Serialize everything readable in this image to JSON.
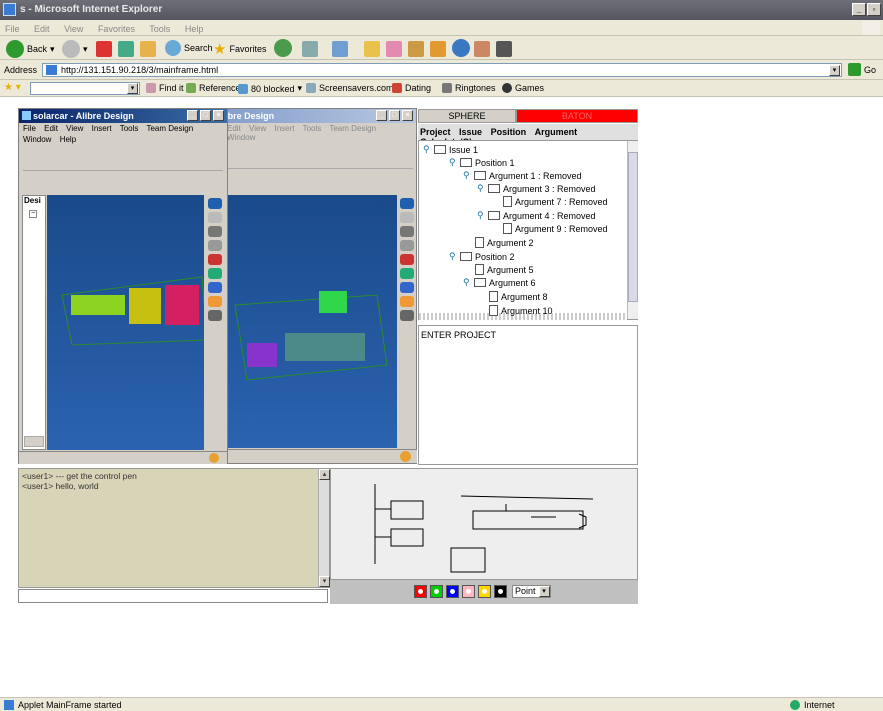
{
  "browser": {
    "title": "s - Microsoft Internet Explorer",
    "menu": [
      "File",
      "Edit",
      "View",
      "Favorites",
      "Tools",
      "Help"
    ],
    "toolbar": {
      "back": "Back",
      "search": "Search",
      "favorites": "Favorites"
    },
    "address_label": "Address",
    "url": "http://131.151.90.218/3/mainframe.html",
    "go_label": "Go",
    "links": {
      "find": "Find it",
      "reference": "Reference",
      "blocked": "80 blocked",
      "screensavers": "Screensavers.com",
      "dating": "Dating",
      "ringtones": "Ringtones",
      "games": "Games"
    },
    "status_text": "Applet MainFrame started",
    "zone": "Internet"
  },
  "alibre_left": {
    "title": "solarcar - Alibre Design",
    "menu1": [
      "File",
      "Edit",
      "View",
      "Insert",
      "Tools",
      "Team Design"
    ],
    "menu2": [
      "Window",
      "Help"
    ],
    "tree_label": "Desi"
  },
  "alibre_right": {
    "title": "sign - Alibre Design",
    "menu": [
      "Edit",
      "View",
      "Insert",
      "Tools",
      "Team Design",
      "Window"
    ]
  },
  "panel": {
    "tab_sphere": "SPHERE",
    "tab_baton": "BATON",
    "menu": [
      "Project",
      "Issue",
      "Position",
      "Argument",
      "Calculate/Clear"
    ],
    "tree": [
      {
        "label": "Issue 1",
        "type": "folder",
        "level": 0
      },
      {
        "label": "Position 1",
        "type": "folder",
        "level": 1
      },
      {
        "label": "Argument 1 : Removed",
        "type": "folder",
        "level": 2
      },
      {
        "label": "Argument 3 : Removed",
        "type": "folder",
        "level": 3
      },
      {
        "label": "Argument 7 : Removed",
        "type": "doc",
        "level": 4
      },
      {
        "label": "Argument 4 : Removed",
        "type": "folder",
        "level": 3
      },
      {
        "label": "Argument 9 : Removed",
        "type": "doc",
        "level": 4
      },
      {
        "label": "Argument 2",
        "type": "doc",
        "level": 2
      },
      {
        "label": "Position 2",
        "type": "folder",
        "level": 1
      },
      {
        "label": "Argument 5",
        "type": "doc",
        "level": 2
      },
      {
        "label": "Argument 6",
        "type": "folder",
        "level": 2
      },
      {
        "label": "Argument 8",
        "type": "doc",
        "level": 3
      },
      {
        "label": "Argument 10",
        "type": "doc",
        "level": 3
      }
    ],
    "project_text": "ENTER PROJECT"
  },
  "chat": {
    "lines": [
      "<user1> --- get the control pen",
      "<user1> hello, world"
    ],
    "input_value": ""
  },
  "draw": {
    "tool": "Point",
    "colors": [
      "#ff0000",
      "#00cc00",
      "#0000ff",
      "#ffb6c1",
      "#ffd700",
      "#000000"
    ]
  }
}
